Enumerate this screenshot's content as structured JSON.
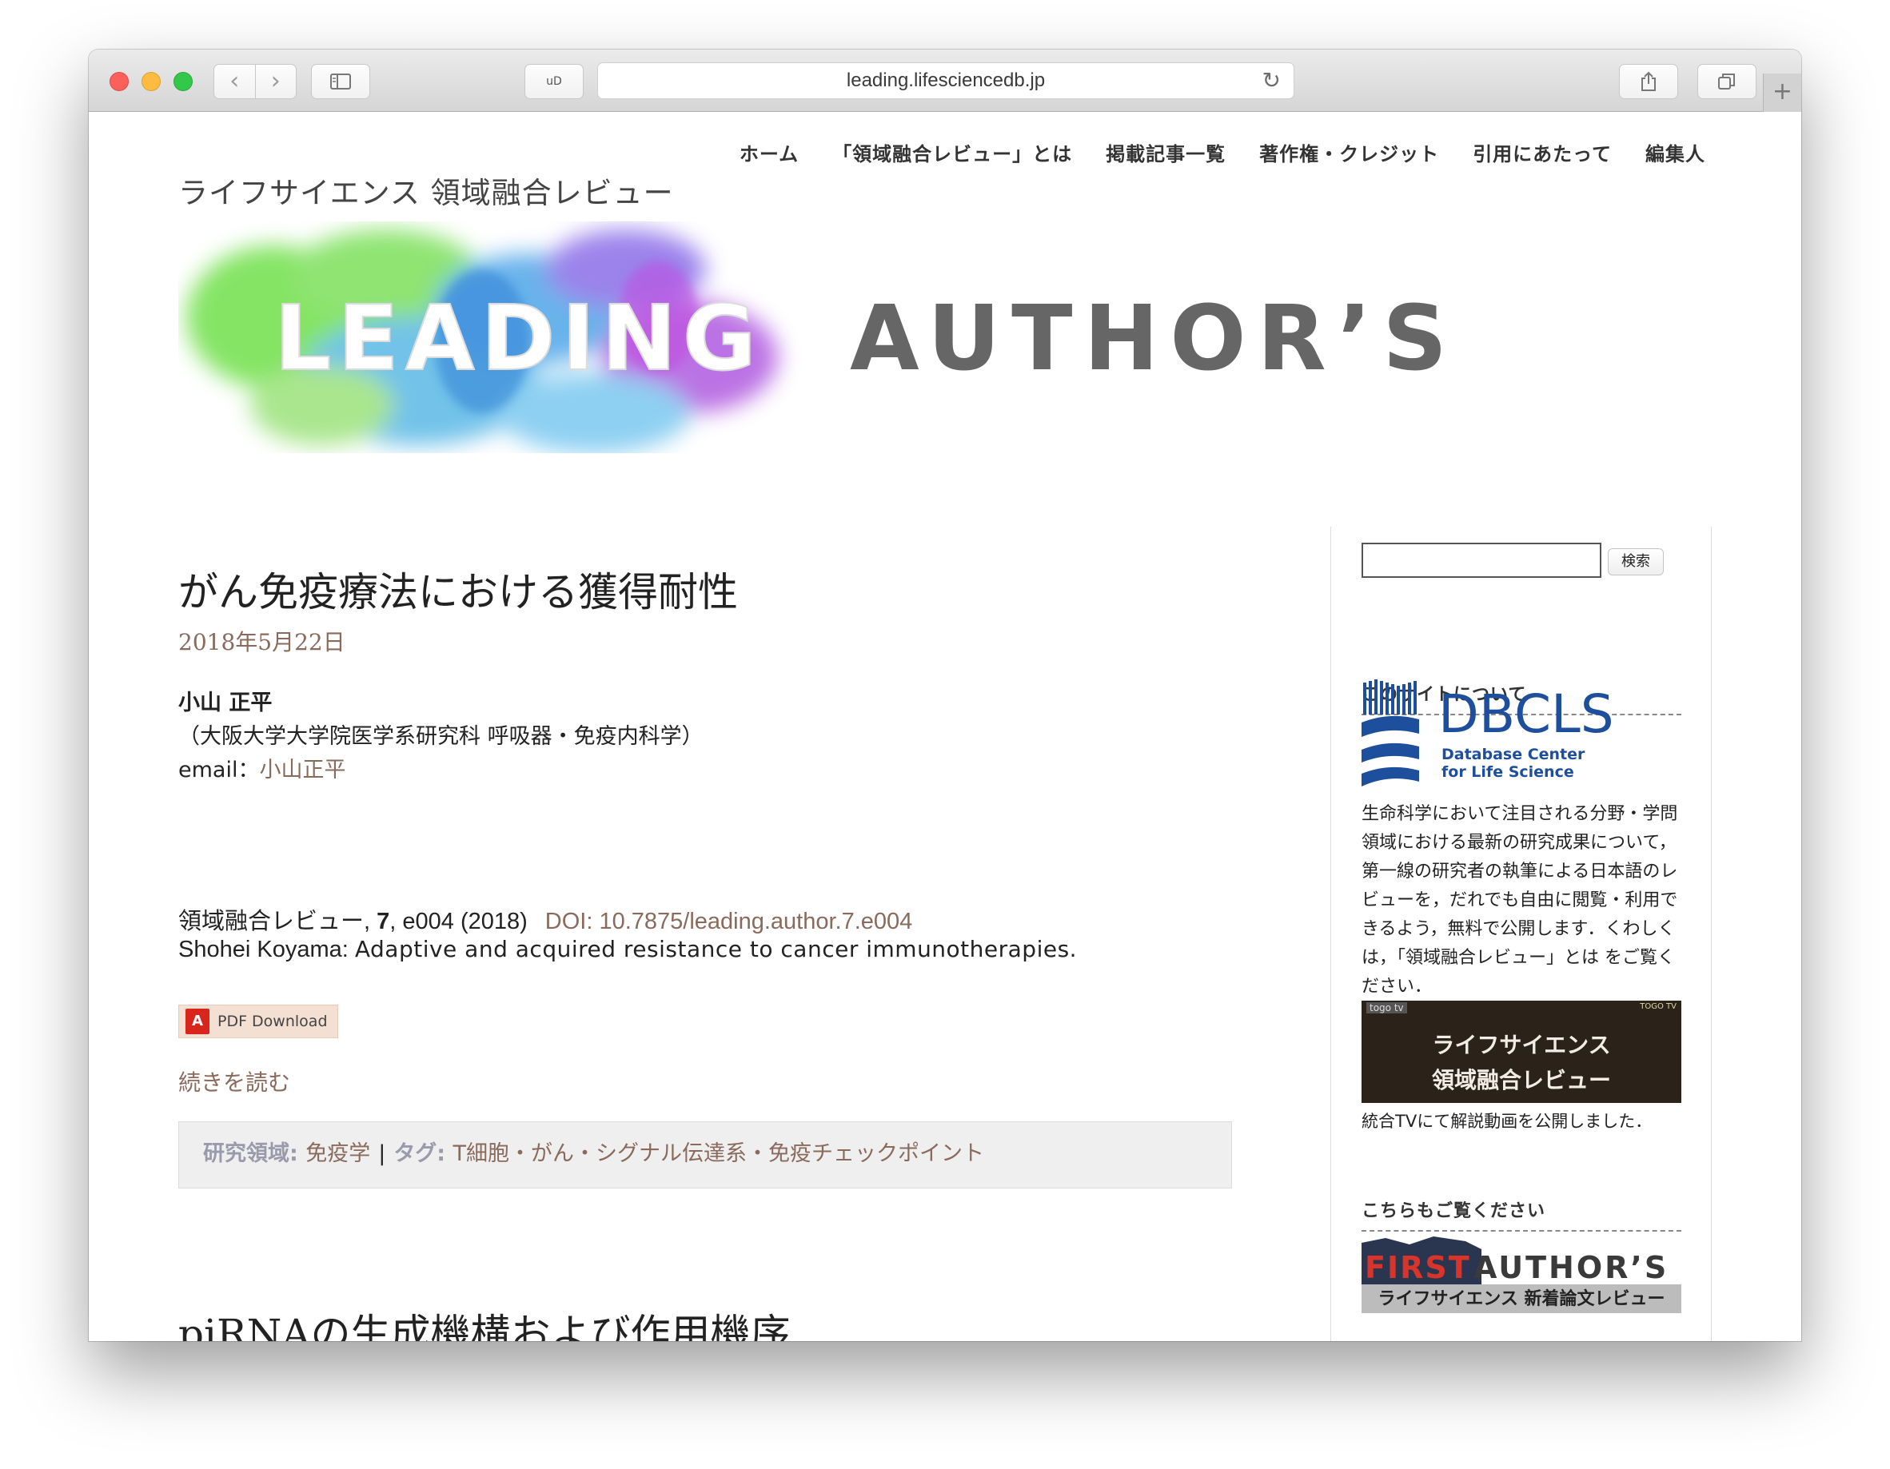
{
  "browser": {
    "url": "leading.lifesciencedb.jp",
    "nav_back": "‹",
    "nav_forward": "›",
    "extension_label": "uD"
  },
  "nav": {
    "items": [
      "ホーム",
      "「領域融合レビュー」とは",
      "掲載記事一覧",
      "著作権・クレジット",
      "引用にあたって",
      "編集人"
    ]
  },
  "header": {
    "site_title": "ライフサイエンス 領域融合レビュー",
    "banner_word1": "LEADING",
    "banner_word2": "AUTHOR’S"
  },
  "post": {
    "title": "がん免疫療法における獲得耐性",
    "date": "2018年5月22日",
    "author_name": "小山 正平",
    "affiliation": "（大阪大学大学院医学系研究科 呼吸器・免疫内科学）",
    "email_label": "email：",
    "email_link": "小山正平",
    "citation_journal": "領域融合レビュー, ",
    "citation_volume": "7",
    "citation_rest": ", e004 (2018)",
    "doi": "DOI: 10.7875/leading.author.7.e004",
    "english_author": "Shohei Koyama: ",
    "english_title": "Adaptive and acquired resistance to cancer immunotherapies.",
    "pdf_label": "PDF Download",
    "read_more": "続きを読む",
    "field_label": "研究領域: ",
    "field_value": "免疫学",
    "pipe": "|",
    "tag_label": "タグ: ",
    "tag_value": "T細胞・がん・シグナル伝達系・免疫チェックポイント"
  },
  "post2": {
    "title": "piRNAの生成機構および作用機序"
  },
  "sidebar": {
    "search_button": "検索",
    "search_value": "",
    "about_title": "このサイトについて",
    "dbcls_name": "DBCLS",
    "dbcls_sub1": "Database Center",
    "dbcls_sub2": "for Life Science",
    "about_text": "生命科学において注目される分野・学問領域における最新の研究成果について，第一線の研究者の執筆による日本語のレビューを，だれでも自由に閲覧・利用できるよう，無料で公開します．くわしくは，「領域融合レビュー」とは をご覧ください．",
    "video_line1": "ライフサイエンス",
    "video_line2": "領域融合レビュー",
    "video_tag1": "togo tv",
    "video_tag2": "TOGO TV",
    "video_caption": "統合TVにて解説動画を公開しました．",
    "also_title": "こちらもご覧ください",
    "first_word1": "FIRST",
    "first_word2": "AUTHOR’S",
    "first_sub": "ライフサイエンス 新着論文レビュー"
  },
  "colors": {
    "link": "#8a6a5c",
    "banner_green": "#7be05a",
    "banner_blue": "#5ab8e6",
    "banner_purple": "#b05ae0"
  }
}
